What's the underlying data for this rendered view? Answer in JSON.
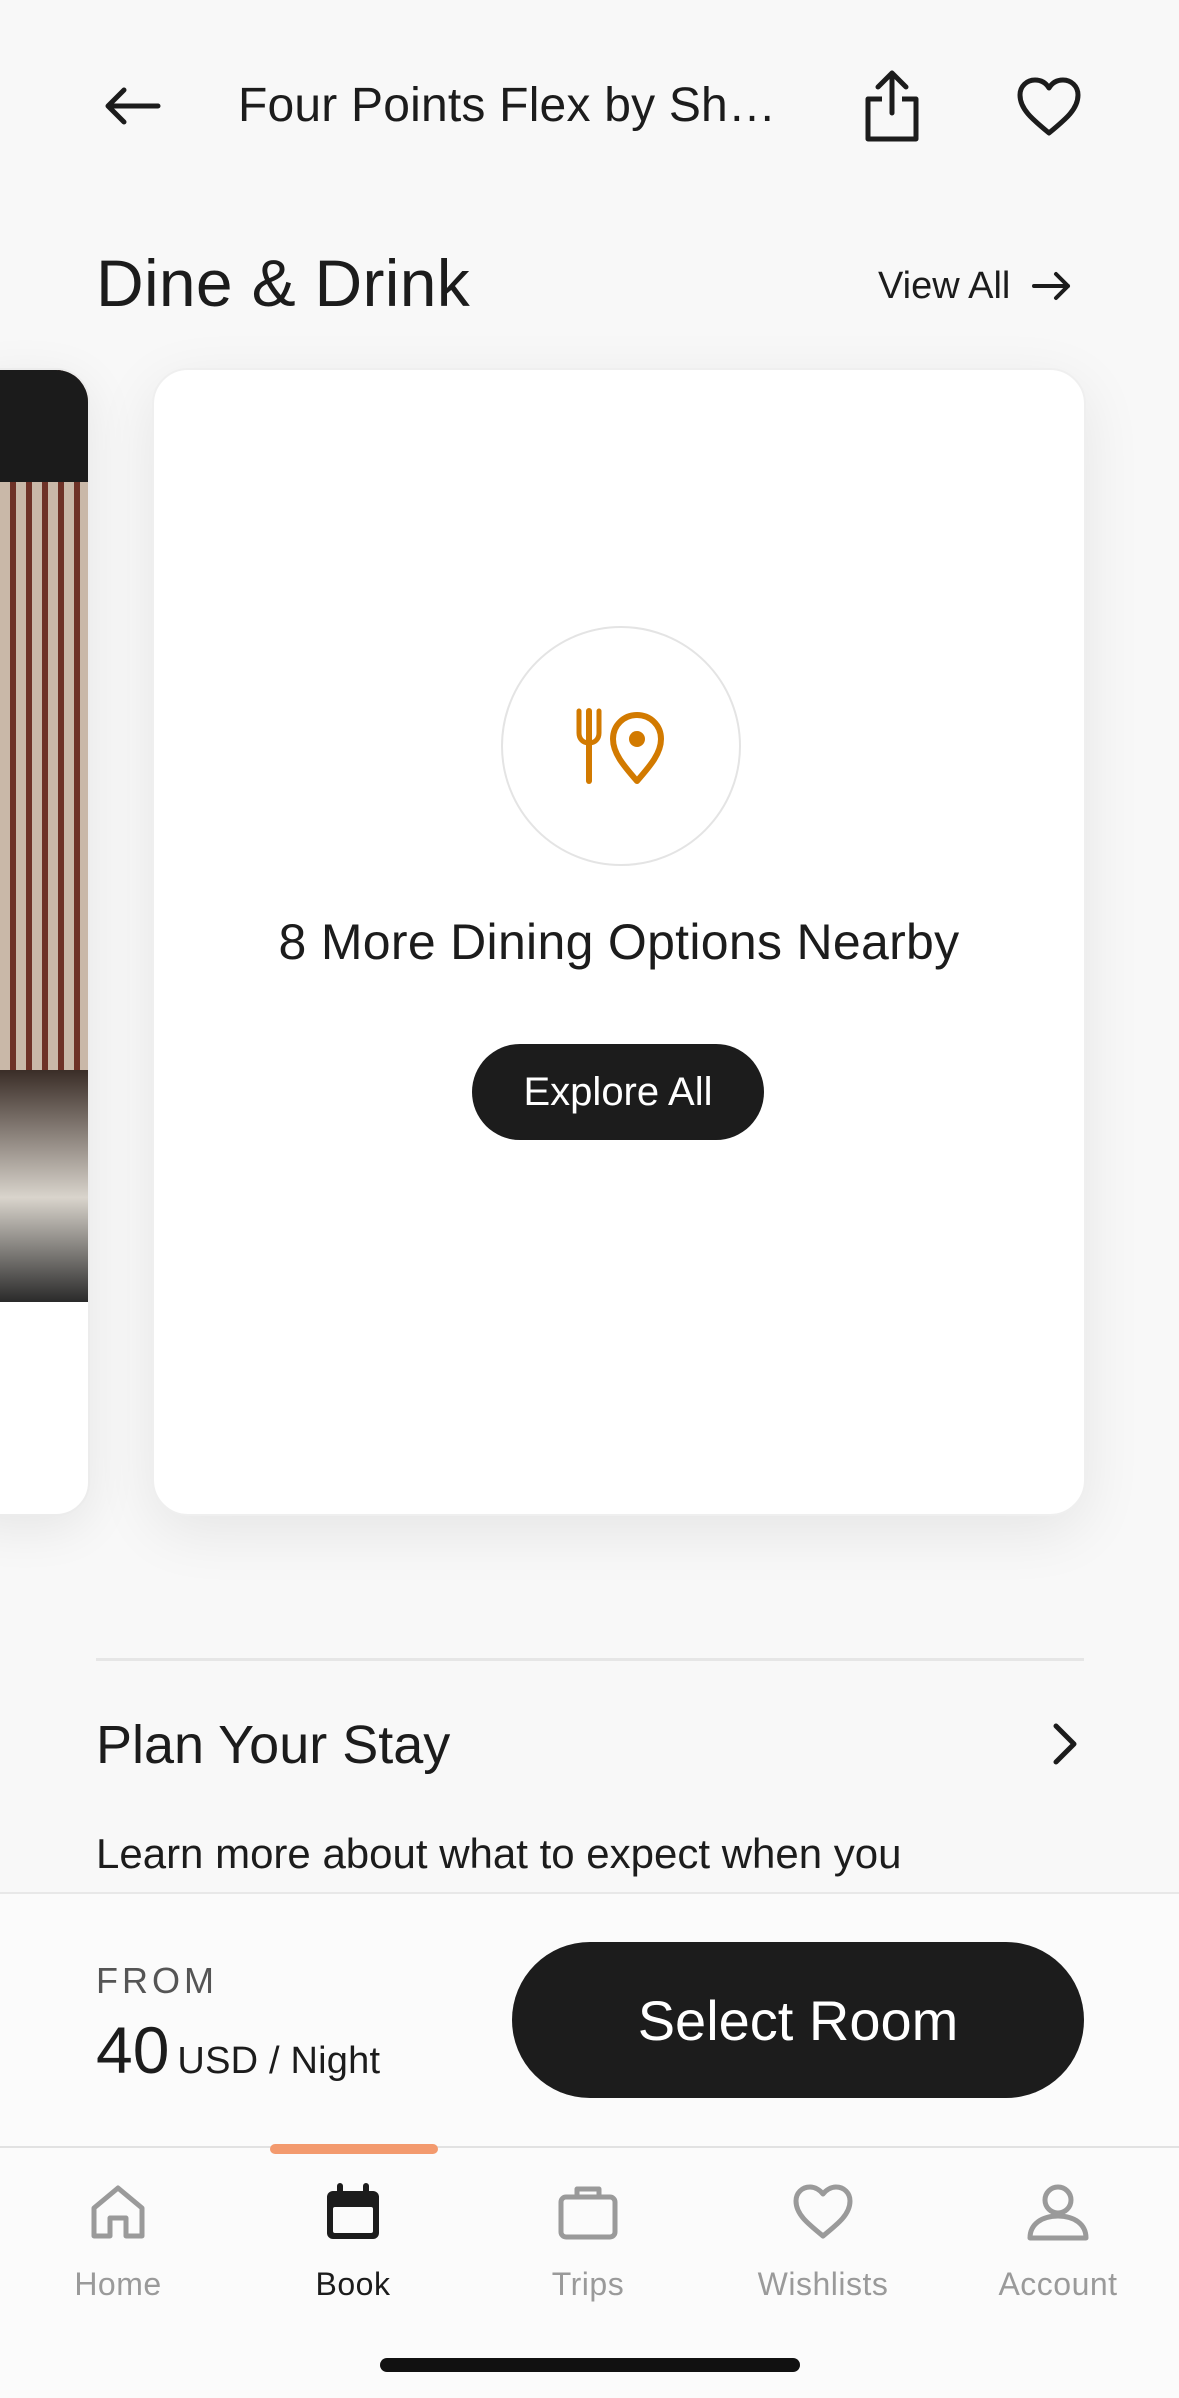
{
  "header": {
    "title": "Four Points Flex by Sheraton",
    "back_icon": "arrow-left-icon",
    "share_icon": "share-icon",
    "favorite_icon": "heart-outline-icon"
  },
  "dine_section": {
    "title": "Dine & Drink",
    "view_all_label": "View All",
    "more_options_text": "8 More Dining Options Nearby",
    "explore_label": "Explore All",
    "accent_color": "#d27a00",
    "dining_icon": "fork-location-pin-icon"
  },
  "plan_section": {
    "title": "Plan Your Stay",
    "description": "Learn more about what to expect when you"
  },
  "booking": {
    "from_label": "FROM",
    "price": "40",
    "unit": "USD / Night",
    "select_label": "Select Room"
  },
  "tabs": [
    {
      "label": "Home",
      "icon": "home-icon",
      "active": false
    },
    {
      "label": "Book",
      "icon": "calendar-icon",
      "active": true
    },
    {
      "label": "Trips",
      "icon": "suitcase-icon",
      "active": false
    },
    {
      "label": "Wishlists",
      "icon": "heart-icon",
      "active": false
    },
    {
      "label": "Account",
      "icon": "person-icon",
      "active": false
    }
  ],
  "colors": {
    "primary": "#1c1c1c",
    "tab_indicator": "#f39a6e",
    "inactive_tab": "#9a9a9a"
  }
}
